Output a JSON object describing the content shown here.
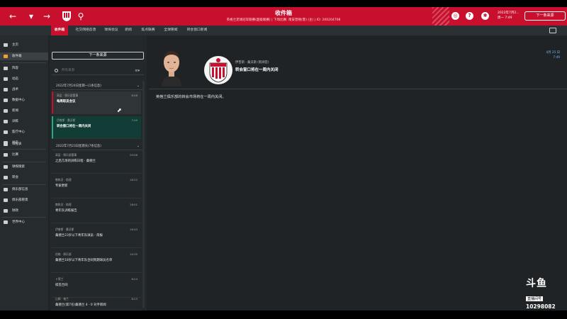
{
  "topbar": {
    "title": "收件箱",
    "subtitle": "英格兰足球冠军联赛(超级联赛) | 下场比赛: 南安普顿(客) (主) | ID: 200204708",
    "date_line1": "2022年7月2...",
    "date_line2": "周一 7:49",
    "next_button": "下一条来源"
  },
  "tabs": [
    {
      "label": "收件箱"
    },
    {
      "label": "社交网络反馈"
    },
    {
      "label": "球探会议"
    },
    {
      "label": "新闻"
    },
    {
      "label": "焦点联赛"
    },
    {
      "label": "全球要闻"
    },
    {
      "label": "转会窗口新闻"
    }
  ],
  "sidebar": {
    "items": [
      {
        "label": "主页"
      },
      {
        "label": "收件箱"
      },
      {
        "label": "阵容"
      },
      {
        "label": "动态"
      },
      {
        "label": "战术"
      },
      {
        "label": "数据中心"
      },
      {
        "label": "新闻"
      },
      {
        "label": "训练"
      },
      {
        "label": "医疗中心"
      },
      {
        "label": "动态"
      },
      {
        "label": "日程表"
      },
      {
        "label": "比赛"
      },
      {
        "label": "球探搜索"
      },
      {
        "label": "转会"
      },
      {
        "label": "俱乐部信息"
      },
      {
        "label": "俱乐部愿景"
      },
      {
        "label": "财政"
      },
      {
        "label": "世界中心"
      }
    ]
  },
  "list": {
    "continue_button": "下一条来源",
    "search_placeholder": "所有来源",
    "sort_icon": "≡▾",
    "groups": [
      {
        "header": "2022年7月24日星期一(1条信息)"
      },
      {
        "header": "2022年7月23日星期天(7条信息)"
      }
    ],
    "messages": [
      {
        "from": "高层 · 俱乐部董事",
        "time": "8:48",
        "subject": "每周职员会议"
      },
      {
        "from": "伊普斯 · 桑沃斯",
        "time": "7:49",
        "subject": "转会窗口将在一周内关闭"
      },
      {
        "from": "高层 · 俱乐部董事",
        "time": "20:06",
        "subject": "之后几场的训练日程 · 桑德兰"
      },
      {
        "from": "教练员 · 助理",
        "time": "18:22",
        "subject": "专家更新"
      },
      {
        "from": "教练员 · 助理",
        "time": "18:01",
        "subject": "青年队训练报告"
      },
      {
        "from": "伊普斯 · 桑沃斯",
        "time": "16:43",
        "subject": "桑德兰23岁以下青年队球员 · 简报"
      },
      {
        "from": "伯格 · 俱乐部",
        "time": "10:35",
        "subject": "桑德兰18岁以下青年队合同到期球员名单"
      },
      {
        "from": "卜莱兰",
        "time": "8:24",
        "subject": "续签合同"
      },
      {
        "from": "山姆 · 格兰",
        "time": "8:23",
        "subject": "桑德兰(第7名)桑德兰 4 - 0 对手新闻"
      }
    ]
  },
  "content": {
    "from": "伊普斯 · 桑沃斯 (新闻官)",
    "subject": "转会窗口将在一周内关闭",
    "meta_date": "4月 25 日",
    "meta_time": "7:49",
    "body": "英格兰俱乐部的转会市场将在一周内关闭。"
  },
  "watermark": {
    "logo": "斗鱼",
    "sub": "直播间号",
    "room_id": "10298082"
  }
}
